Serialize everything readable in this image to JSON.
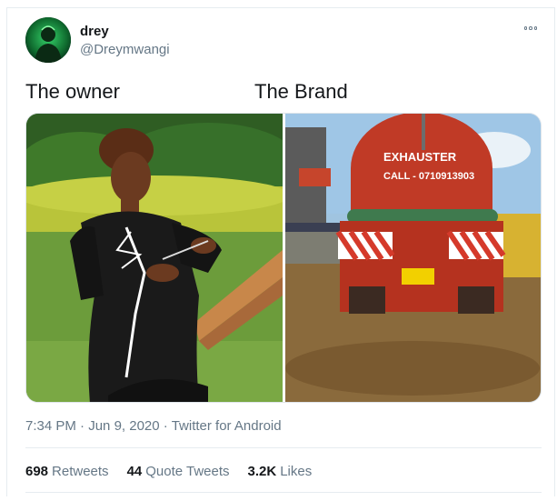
{
  "author": {
    "name": "drey",
    "handle": "@Dreymwangi"
  },
  "tweet": {
    "text_left": "The owner",
    "text_right": "The Brand",
    "time": "7:34 PM",
    "separator": "·",
    "date": "Jun 9, 2020",
    "source": "Twitter for Android"
  },
  "media": {
    "truck_sign_line1": "EXHAUSTER",
    "truck_sign_line2": "CALL - 0710913903"
  },
  "stats": [
    {
      "count": "698",
      "label": "Retweets"
    },
    {
      "count": "44",
      "label": "Quote Tweets"
    },
    {
      "count": "3.2K",
      "label": "Likes"
    }
  ],
  "icons": {
    "more": "more-options-icon"
  },
  "colors": {
    "muted": "#657786",
    "text": "#14171a",
    "border": "#e6ecf0"
  }
}
